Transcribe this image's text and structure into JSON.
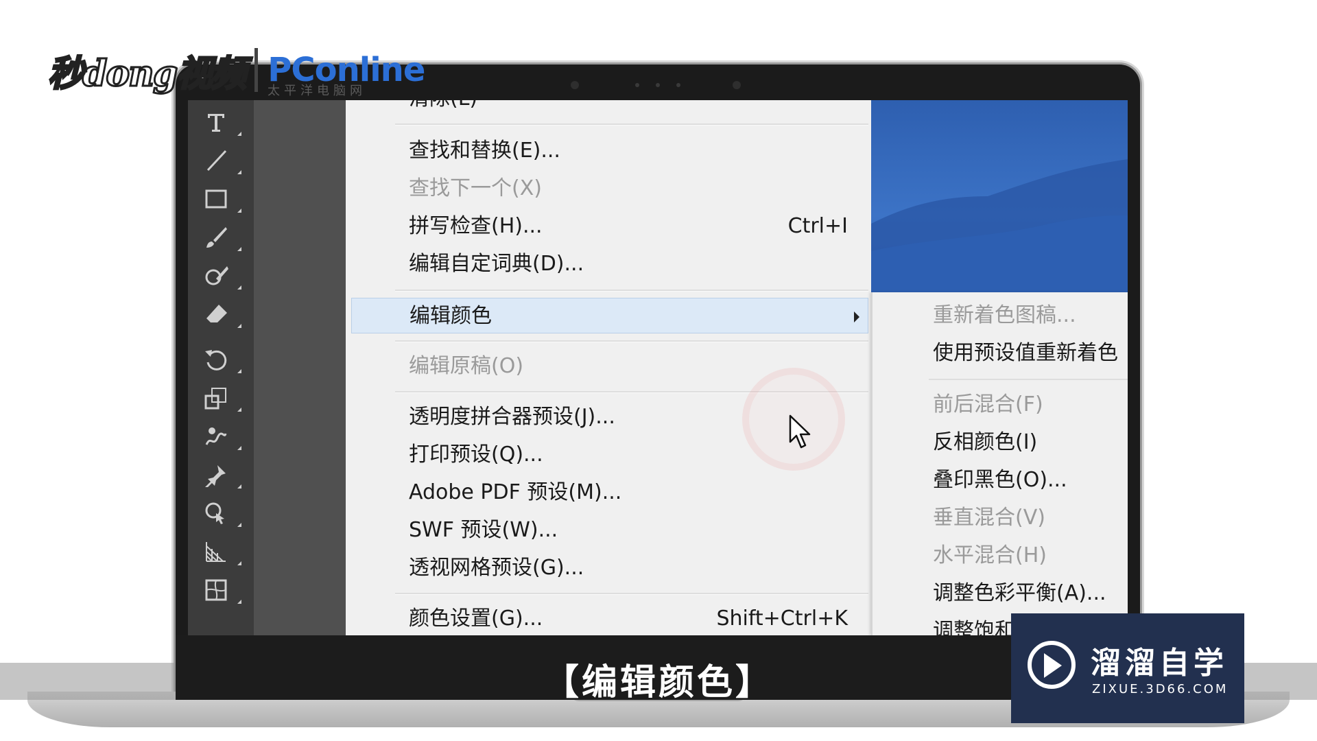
{
  "menu": {
    "items": [
      {
        "label": "清除(L)",
        "shortcut": "",
        "disabled": false
      },
      {
        "label": "查找和替换(E)...",
        "shortcut": "",
        "disabled": false
      },
      {
        "label": "查找下一个(X)",
        "shortcut": "",
        "disabled": true
      },
      {
        "label": "拼写检查(H)...",
        "shortcut": "Ctrl+I",
        "disabled": false
      },
      {
        "label": "编辑自定词典(D)...",
        "shortcut": "",
        "disabled": false
      },
      {
        "label": "编辑颜色",
        "shortcut": "",
        "disabled": false,
        "highlighted": true,
        "has_submenu": true
      },
      {
        "label": "编辑原稿(O)",
        "shortcut": "",
        "disabled": true
      },
      {
        "label": "透明度拼合器预设(J)...",
        "shortcut": "",
        "disabled": false
      },
      {
        "label": "打印预设(Q)...",
        "shortcut": "",
        "disabled": false
      },
      {
        "label": "Adobe PDF 预设(M)...",
        "shortcut": "",
        "disabled": false
      },
      {
        "label": "SWF 预设(W)...",
        "shortcut": "",
        "disabled": false
      },
      {
        "label": "透视网格预设(G)...",
        "shortcut": "",
        "disabled": false
      },
      {
        "label": "颜色设置(G)...",
        "shortcut": "Shift+Ctrl+K",
        "disabled": false
      }
    ]
  },
  "submenu": {
    "items": [
      {
        "label": "重新着色图稿...",
        "disabled": true
      },
      {
        "label": "使用预设值重新着色",
        "disabled": false
      },
      {
        "label": "前后混合(F)",
        "disabled": true
      },
      {
        "label": "反相颜色(I)",
        "disabled": false
      },
      {
        "label": "叠印黑色(O)...",
        "disabled": false
      },
      {
        "label": "垂直混合(V)",
        "disabled": true
      },
      {
        "label": "水平混合(H)",
        "disabled": true
      },
      {
        "label": "调整色彩平衡(A)...",
        "disabled": false
      },
      {
        "label": "调整饱和度...",
        "disabled": false
      }
    ]
  },
  "tools": [
    "type-tool-icon",
    "line-tool-icon",
    "rectangle-tool-icon",
    "paintbrush-tool-icon",
    "blob-brush-tool-icon",
    "eraser-tool-icon",
    "rotate-tool-icon",
    "scale-tool-icon",
    "warp-tool-icon",
    "puppet-warp-tool-icon",
    "shape-builder-tool-icon",
    "perspective-grid-tool-icon",
    "mesh-tool-icon"
  ],
  "subtitle": "【编辑颜色】",
  "watermark_left": {
    "brand": "秒dong视频",
    "partner": "PConline",
    "partner_sub": "太平洋电脑网"
  },
  "watermark_right": {
    "name": "溜溜自学",
    "url": "ZIXUE.3D66.COM"
  },
  "colors": {
    "menu_bg": "#f0f0f0",
    "highlight": "#dce9f7",
    "disabled_text": "#9a9a9a",
    "canvas_blue": "#3c73c6",
    "brand_navy": "#22304f"
  }
}
